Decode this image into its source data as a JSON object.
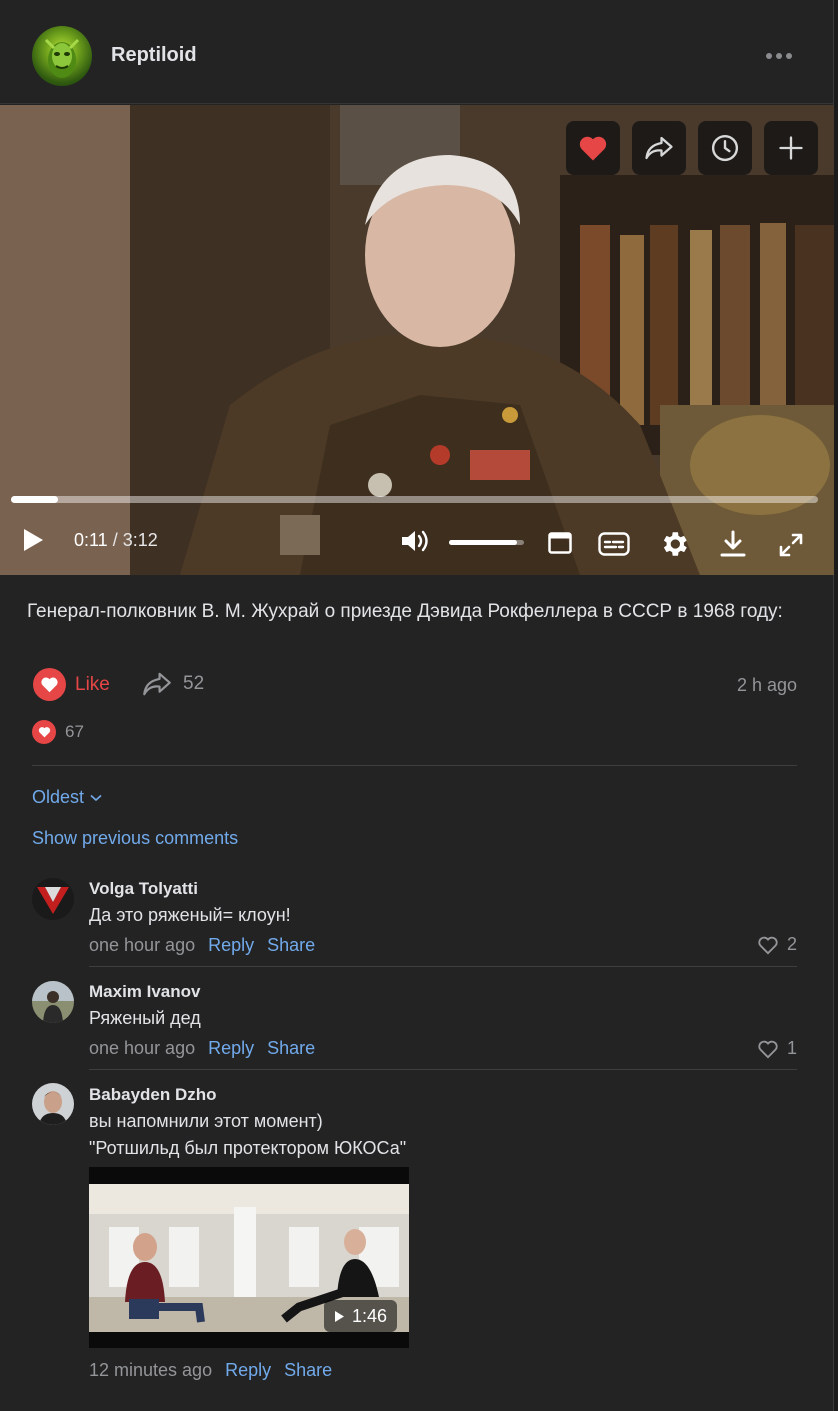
{
  "post": {
    "author": "Reptiloid",
    "text": "Генерал-полковник В. М. Жухрай о приезде Дэвида Рокфеллера в СССР в 1968 году:",
    "time": "2 h ago",
    "like_label": "Like",
    "share_count": "52",
    "reaction_count": "67"
  },
  "video": {
    "current_time": "0:11",
    "separator": " / ",
    "duration": "3:12",
    "progress": 0.058,
    "volume": 0.9,
    "overlay_actions": [
      "heart-icon",
      "share-icon",
      "clock-icon",
      "plus-icon"
    ],
    "controls": [
      "play-icon",
      "volume-icon",
      "miniplayer-icon",
      "subtitles-icon",
      "settings-icon",
      "download-icon",
      "fullscreen-icon"
    ]
  },
  "comments_section": {
    "sort_label": "Oldest",
    "show_previous": "Show previous comments"
  },
  "comments": [
    {
      "name": "Volga Tolyatti",
      "text": "Да это ряженый= клоун!",
      "time": "one hour ago",
      "reply": "Reply",
      "share": "Share",
      "likes": "2"
    },
    {
      "name": "Maxim Ivanov",
      "text": "Ряженый дед",
      "time": "one hour ago",
      "reply": "Reply",
      "share": "Share",
      "likes": "1"
    },
    {
      "name": "Babayden Dzho",
      "text_line1": "вы напомнили этот момент)",
      "text_line2": "\"Ротшильд был протектором ЮКОСа\"",
      "attachment_duration": "1:46",
      "time": "12 minutes ago",
      "reply": "Reply",
      "share": "Share"
    }
  ],
  "colors": {
    "background": "#232324",
    "accent_link": "#71aaeb",
    "like_red": "#e64646",
    "muted_text": "#939598"
  }
}
